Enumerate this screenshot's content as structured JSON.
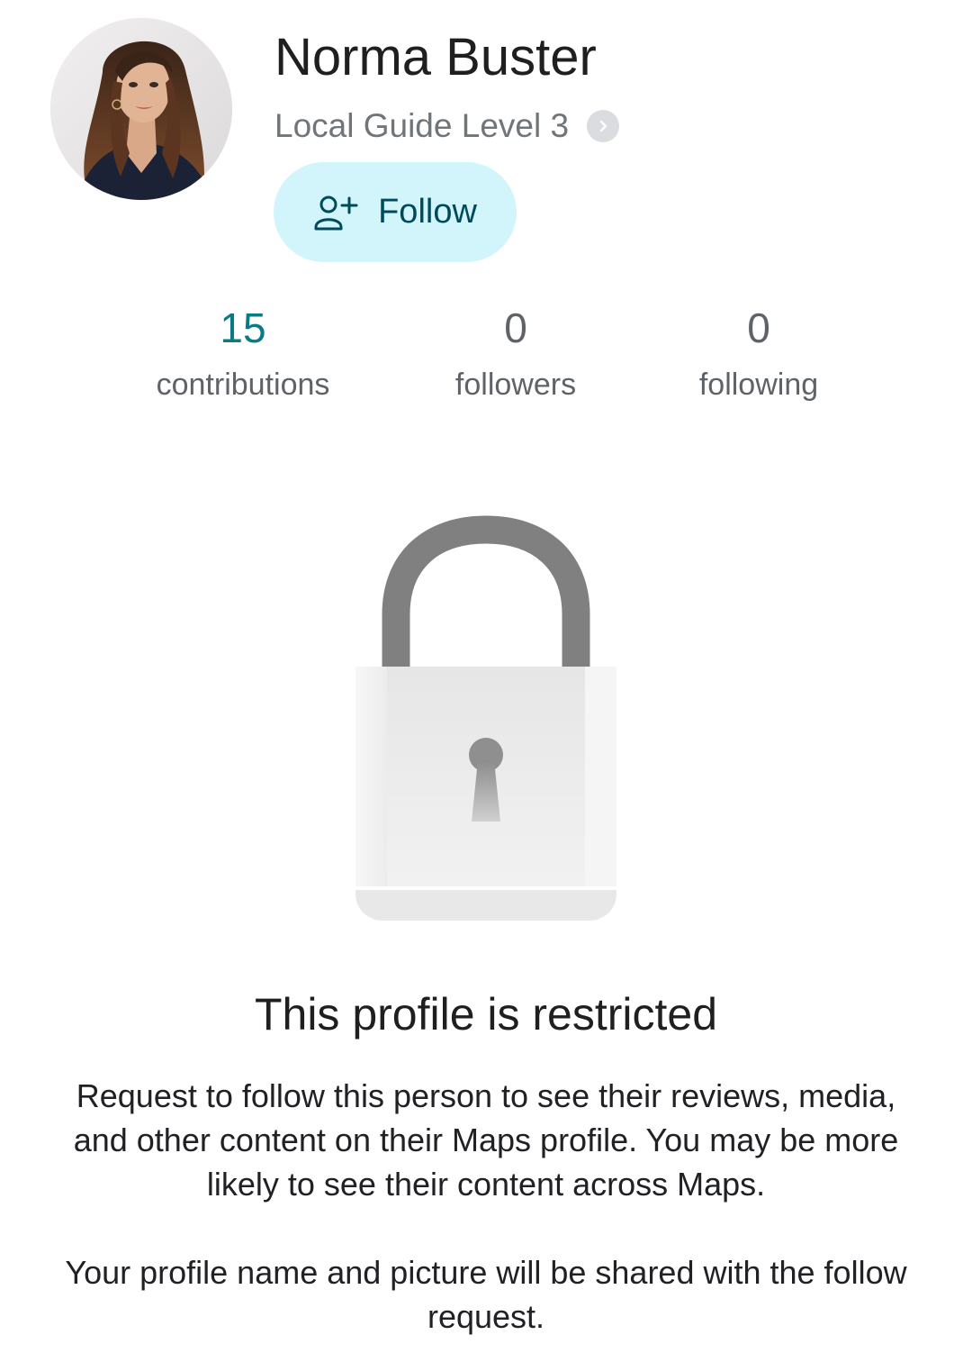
{
  "profile": {
    "name": "Norma Buster",
    "level": "Local Guide Level 3",
    "follow_label": "Follow"
  },
  "stats": [
    {
      "count": "15",
      "label": "contributions"
    },
    {
      "count": "0",
      "label": "followers"
    },
    {
      "count": "0",
      "label": "following"
    }
  ],
  "restricted": {
    "title": "This profile is restricted",
    "paragraph1": "Request to follow this person to see their reviews, media, and other content on their Maps profile. You may be more likely to see their content across Maps.",
    "paragraph2": "Your profile name and picture will be shared with the follow request."
  },
  "icons": {
    "avatar": "profile-photo",
    "level": "chevron-right-icon",
    "follow": "person-add-icon",
    "lock": "padlock-icon"
  },
  "colors": {
    "accent_count": "#0b7a86",
    "follow_button_bg": "#d2f5fc",
    "follow_button_text": "#004a5c",
    "secondary_text": "#70757a"
  }
}
